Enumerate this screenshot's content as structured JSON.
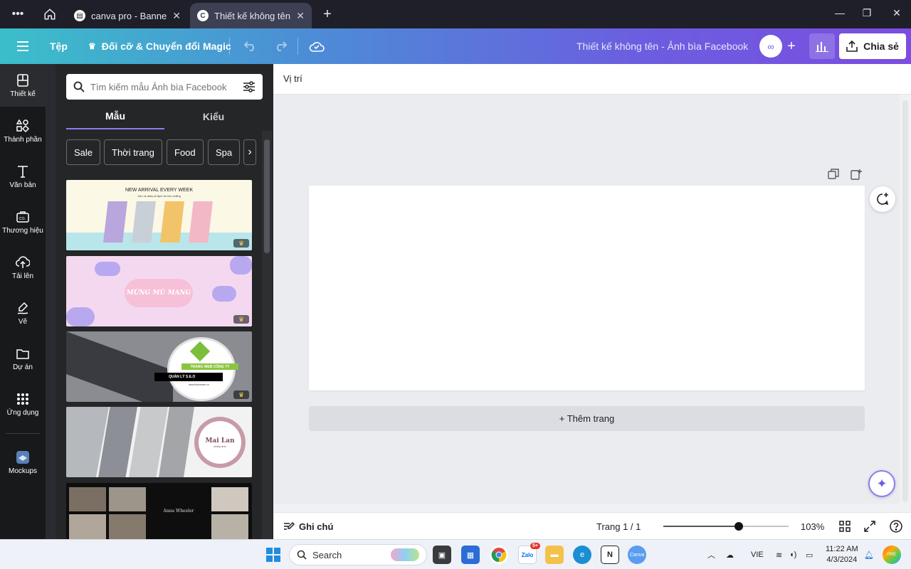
{
  "browser": {
    "tabs": [
      {
        "label": "canva pro - Banner...",
        "active": false
      },
      {
        "label": "Thiết kế không tên...",
        "active": true
      }
    ]
  },
  "toolbar": {
    "file_label": "Tệp",
    "magic_resize_label": "Đối cỡ & Chuyển đổi Magic",
    "doc_title": "Thiết kế không tên - Ảnh bìa Facebook",
    "share_label": "Chia sẻ"
  },
  "rail": {
    "items": [
      {
        "label": "Thiết kế",
        "icon": "layout-icon"
      },
      {
        "label": "Thành phần",
        "icon": "shapes-icon"
      },
      {
        "label": "Văn bản",
        "icon": "text-icon"
      },
      {
        "label": "Thương hiệu",
        "icon": "brand-icon"
      },
      {
        "label": "Tải lên",
        "icon": "upload-icon"
      },
      {
        "label": "Vẽ",
        "icon": "draw-icon"
      },
      {
        "label": "Dự án",
        "icon": "folder-icon"
      },
      {
        "label": "Ứng dụng",
        "icon": "apps-icon"
      },
      {
        "label": "Mockups",
        "icon": "mockups-icon"
      }
    ]
  },
  "panel": {
    "search_placeholder": "Tìm kiếm mẫu Ảnh bìa Facebook",
    "tabs": [
      "Mẫu",
      "Kiểu"
    ],
    "chips": [
      "Sale",
      "Thời trang",
      "Food",
      "Spa"
    ],
    "templates": [
      {
        "title": "NEW ARRIVAL EVERY WEEK",
        "subtitle": "Join us daily at 8pm for live selling"
      },
      {
        "title": "MỪNG MÙ MANG"
      },
      {
        "title": "TRANG WEB CÔNG TY",
        "subtitle": "QUẢN LÝ S.E.O",
        "url": "www.thiekeweb.vn"
      },
      {
        "title": "Mai Lan",
        "subtitle": "nhiếp ảnh"
      },
      {
        "title": "Anna Wheeler"
      }
    ]
  },
  "context": {
    "position_label": "Vị trí"
  },
  "canvas": {
    "add_page_label": "+ Thêm trang"
  },
  "bottombar": {
    "notes_label": "Ghi chú",
    "page_indicator": "Trang 1 / 1",
    "zoom_label": "103%",
    "zoom_fraction": 0.6
  },
  "taskbar": {
    "search_label": "Search",
    "lang": "VIE",
    "time": "11:22 AM",
    "date": "4/3/2024",
    "zalo_badge": "5+"
  },
  "colors": {
    "accent": "#7b4de0",
    "toolbar_start": "#3bbfca",
    "rail_bg": "#18191b",
    "panel_bg": "#252627"
  }
}
